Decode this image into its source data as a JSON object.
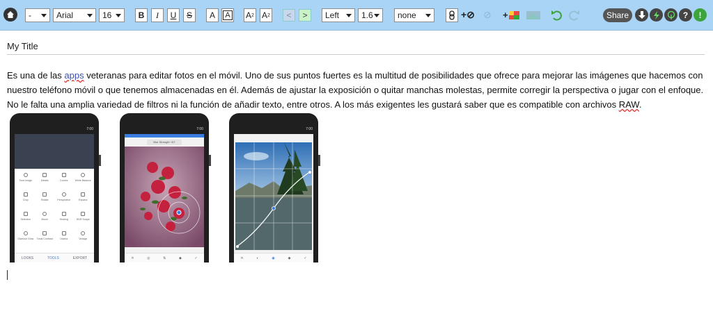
{
  "toolbar": {
    "format_select": "-",
    "font_select": "Arial",
    "size_select": "16",
    "bold": "B",
    "italic": "I",
    "underline": "U",
    "strike": "S",
    "text_color": "A",
    "bg_color": "A",
    "superscript": "A",
    "subscript": "A",
    "prev": "<",
    "next": ">",
    "align_select": "Left",
    "line_height_select": "1.6",
    "list_select": "none",
    "share_label": "Share",
    "help_label": "?"
  },
  "document": {
    "title": "My Title",
    "paragraph": {
      "part1": "Es una de las ",
      "link": "apps",
      "part2": " veteranas para editar fotos en el móvil. Uno de sus puntos fuertes es la multitud de posibilidades que ofrece para mejorar las imágenes que hacemos con nuestro teléfono móvil o que tenemos almacenadas en él. Además de ajustar la exposición o quitar manchas molestas, permite corregir la perspectiva o jugar con el enfoque. No le falta una amplia variedad de filtros ni la función de añadir texto, entre otros. A los más exigentes les gustará saber que es compatible con archivos ",
      "raw": "RAW",
      "part3": "."
    }
  },
  "phones": [
    {
      "tabs": [
        "LOOKS",
        "TOOLS",
        "EXPORT"
      ],
      "tools": [
        "Tune image",
        "Details",
        "Curves",
        "White Balance",
        "Crop",
        "Rotate",
        "Perspective",
        "Expand",
        "Selective",
        "Brush",
        "Healing",
        "HDR Scape",
        "Glamour Glow",
        "Tonal Contrast",
        "Drama",
        "Vintage"
      ]
    },
    {
      "label": "Blur Strength +67"
    },
    {}
  ],
  "status_time": "7:00",
  "colors": {
    "toolbar_bg": "#a9d4f5",
    "accent_green": "#3da33d"
  }
}
